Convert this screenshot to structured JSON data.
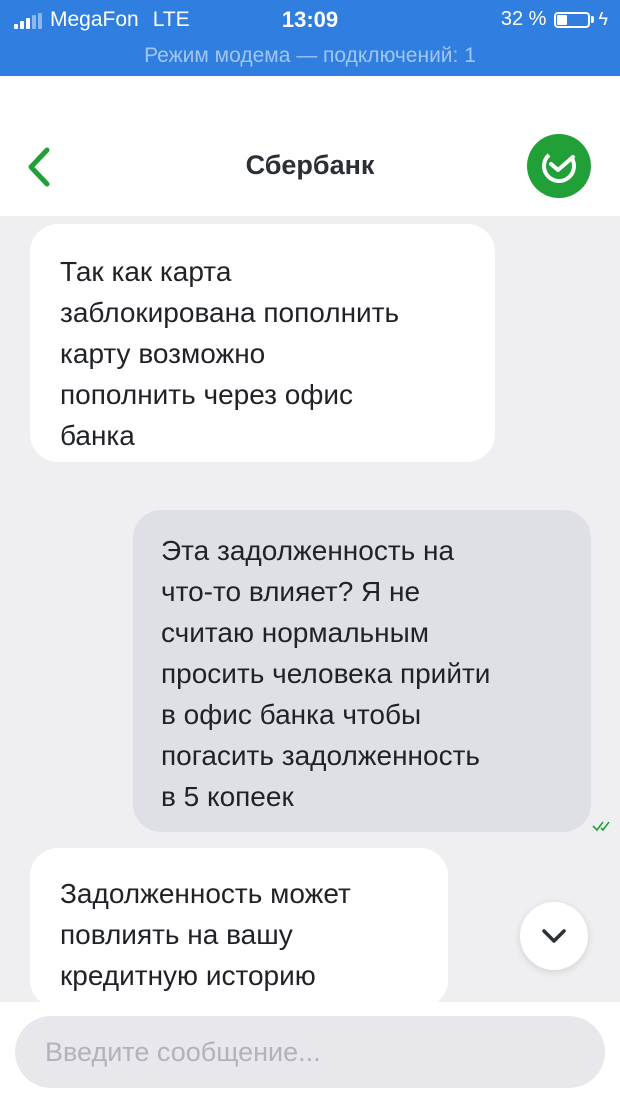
{
  "status_bar": {
    "carrier": "MegaFon",
    "network": "LTE",
    "time": "13:09",
    "battery": "32 %",
    "battery_level": 0.32
  },
  "modem_banner": "Режим модема — подключений: 1",
  "header": {
    "title": "Сбербанк",
    "back_icon": "chevron-left-icon",
    "logo_icon": "sberbank-logo-icon"
  },
  "messages": [
    {
      "direction": "incoming",
      "text": " Так как карта\nзаблокирована пополнить\nкарту возможно\nпополнить через офис\nбанка"
    },
    {
      "direction": "outgoing",
      "text": "Эта задолженность на\nчто-то влияет? Я не\nсчитаю нормальным\nпросить человека прийти\nв офис банка чтобы\nпогасить задолженность\nв 5 копеек",
      "status_icon": "double-check-icon"
    },
    {
      "direction": "incoming",
      "text": "Задолженность может\nповлиять на вашу\nкредитную историю"
    }
  ],
  "scroll_down_icon": "chevron-down-icon",
  "input": {
    "placeholder": "Введите сообщение...",
    "value": ""
  },
  "colors": {
    "status_bar": "#2f7ee0",
    "accent_green": "#21a038",
    "chat_background": "#efeff2",
    "outgoing_bubble": "#dfe0e5",
    "incoming_bubble": "#ffffff"
  }
}
